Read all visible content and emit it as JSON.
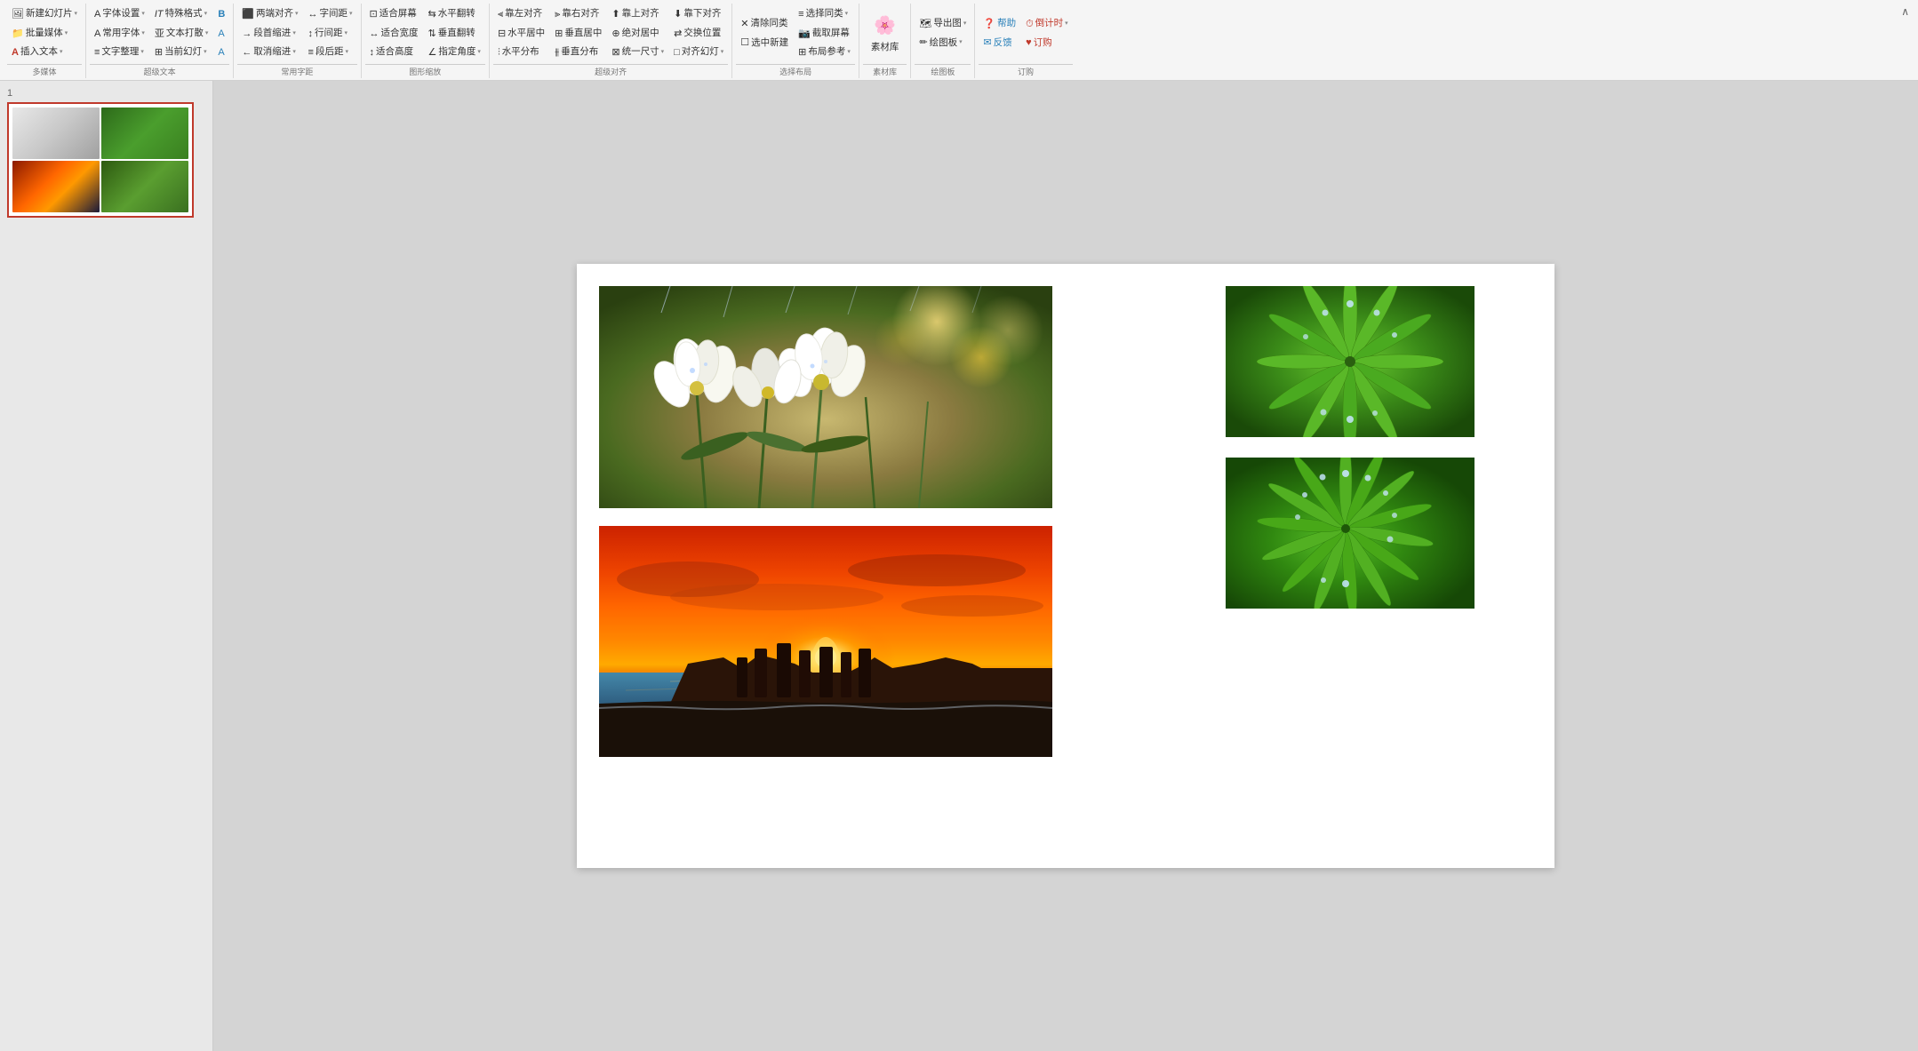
{
  "ribbon": {
    "groups": [
      {
        "id": "media",
        "label": "多媒体",
        "buttons": [
          {
            "id": "new-slide",
            "icon": "🖼",
            "text": "新建幻灯片",
            "arrow": true,
            "color": ""
          },
          {
            "id": "batch-media",
            "icon": "📁",
            "text": "批量媒体",
            "arrow": true,
            "color": "orange"
          },
          {
            "id": "insert-text",
            "icon": "A",
            "text": "插入文本▼",
            "arrow": false,
            "color": "orange"
          }
        ]
      },
      {
        "id": "supertext",
        "label": "超级文本",
        "buttons": [
          {
            "id": "font-setting",
            "icon": "A",
            "text": "字体设置",
            "arrow": true
          },
          {
            "id": "common-font",
            "icon": "A",
            "text": "常用字体",
            "arrow": true
          },
          {
            "id": "text-layout",
            "icon": "≡",
            "text": "文字整理",
            "arrow": true
          },
          {
            "id": "special-format",
            "icon": "IT",
            "text": "特殊格式",
            "arrow": true
          },
          {
            "id": "text-punch",
            "icon": "亚",
            "text": "文本打散",
            "arrow": true
          },
          {
            "id": "current-slide",
            "icon": "⊞",
            "text": "当前幻灯",
            "arrow": true
          },
          {
            "id": "bold-b",
            "icon": "B",
            "text": "",
            "arrow": false,
            "color": "blue"
          },
          {
            "id": "font-a1",
            "icon": "A",
            "text": "",
            "arrow": false,
            "color": "blue"
          },
          {
            "id": "font-a2",
            "icon": "A",
            "text": "",
            "arrow": false,
            "color": "blue"
          }
        ]
      },
      {
        "id": "spacing",
        "label": "常用字距",
        "buttons": [
          {
            "id": "align-justify",
            "icon": "≡",
            "text": "两端对齐",
            "arrow": true
          },
          {
            "id": "para-indent",
            "icon": "→≡",
            "text": "段首缩进",
            "arrow": true
          },
          {
            "id": "cancel-indent",
            "icon": "←≡",
            "text": "取消缩进",
            "arrow": true
          },
          {
            "id": "char-spacing",
            "icon": "↔A",
            "text": "字间距",
            "arrow": true
          },
          {
            "id": "line-spacing",
            "icon": "↕≡",
            "text": "行间距",
            "arrow": true
          },
          {
            "id": "para-after",
            "icon": "≡↓",
            "text": "段后距",
            "arrow": true
          }
        ]
      },
      {
        "id": "shape-zoom",
        "label": "图形缩放",
        "buttons": [
          {
            "id": "fit-screen",
            "icon": "⊡",
            "text": "适合屏幕",
            "arrow": false
          },
          {
            "id": "fit-width",
            "icon": "↔",
            "text": "适合宽度",
            "arrow": false
          },
          {
            "id": "fit-height",
            "icon": "↕",
            "text": "适合高度",
            "arrow": false
          },
          {
            "id": "h-flip",
            "icon": "↔",
            "text": "水平翻转",
            "arrow": false
          },
          {
            "id": "v-flip",
            "icon": "↕",
            "text": "垂直翻转",
            "arrow": false
          },
          {
            "id": "point-angle",
            "icon": "∠",
            "text": "指定角度",
            "arrow": true
          }
        ]
      },
      {
        "id": "super-align",
        "label": "超级对齐",
        "buttons": [
          {
            "id": "align-left",
            "icon": "⫷",
            "text": "靠左对齐",
            "arrow": false
          },
          {
            "id": "align-right",
            "icon": "⫸",
            "text": "靠右对齐",
            "arrow": false
          },
          {
            "id": "align-top",
            "icon": "⫶",
            "text": "靠上对齐",
            "arrow": false
          },
          {
            "id": "align-bottom",
            "icon": "⫵",
            "text": "靠下对齐",
            "arrow": false
          },
          {
            "id": "h-center",
            "icon": "⊟",
            "text": "水平居中",
            "arrow": false
          },
          {
            "id": "v-center",
            "icon": "⊞",
            "text": "垂直居中",
            "arrow": false
          },
          {
            "id": "abs-center",
            "icon": "⊕",
            "text": "绝对居中",
            "arrow": false
          },
          {
            "id": "h-distribute",
            "icon": "|||",
            "text": "水平分布",
            "arrow": false
          },
          {
            "id": "v-distribute",
            "icon": "≡≡",
            "text": "垂直分布",
            "arrow": false
          },
          {
            "id": "uniform-size",
            "icon": "⊠",
            "text": "统一尺寸",
            "arrow": true
          },
          {
            "id": "swap-pos",
            "icon": "⇄",
            "text": "交换位置",
            "arrow": false
          },
          {
            "id": "align-slide",
            "icon": "□",
            "text": "对齐幻灯",
            "arrow": true
          }
        ]
      },
      {
        "id": "select-layout",
        "label": "选择布局",
        "buttons": [
          {
            "id": "clear-same",
            "icon": "✕",
            "text": "清除同类",
            "arrow": false
          },
          {
            "id": "select-new",
            "icon": "☐",
            "text": "选中新建",
            "arrow": false
          },
          {
            "id": "select-same",
            "icon": "≡",
            "text": "选择同类",
            "arrow": false
          },
          {
            "id": "screenshot",
            "icon": "📷",
            "text": "截取屏幕",
            "arrow": false
          },
          {
            "id": "layout-ref",
            "icon": "⊞",
            "text": "布局参考",
            "arrow": true
          }
        ]
      },
      {
        "id": "material",
        "label": "素材库",
        "buttons": [
          {
            "id": "material-lib",
            "icon": "🌸",
            "text": "素材库",
            "arrow": false,
            "color": "orange"
          }
        ]
      },
      {
        "id": "drawing-board",
        "label": "绘图板",
        "buttons": [
          {
            "id": "export-map",
            "icon": "🗺",
            "text": "导出图▼",
            "arrow": true
          },
          {
            "id": "drawing-board-btn",
            "icon": "✏",
            "text": "绘图板▼",
            "arrow": true
          }
        ]
      },
      {
        "id": "order",
        "label": "订购",
        "buttons": [
          {
            "id": "help",
            "icon": "?",
            "text": "帮助",
            "color": "blue"
          },
          {
            "id": "feedback",
            "icon": "✉",
            "text": "反馈",
            "color": "blue"
          },
          {
            "id": "countdown",
            "icon": "⏱",
            "text": "倒计时▼",
            "color": "orange"
          },
          {
            "id": "subscribe",
            "icon": "♥",
            "text": "订购",
            "color": "orange"
          }
        ]
      }
    ]
  },
  "slide": {
    "number": "1",
    "photos": [
      {
        "id": "flowers",
        "desc": "白色花朵特写",
        "position": "top-left"
      },
      {
        "id": "green1",
        "desc": "绿色植物叶片",
        "position": "top-right"
      },
      {
        "id": "sunset",
        "desc": "日落海岸风景",
        "position": "bottom-left"
      },
      {
        "id": "green2",
        "desc": "绿色植物叶片2",
        "position": "bottom-right"
      }
    ]
  },
  "ribbon_rows": {
    "row1": {
      "items": [
        {
          "text": "新建幻灯片",
          "icon": "slide"
        },
        {
          "text": "批量媒体",
          "icon": "folder"
        },
        {
          "text": "插入文本▼",
          "icon": "text"
        },
        {
          "sep": true
        },
        {
          "text": "字体设置▼",
          "icon": "font"
        },
        {
          "text": "常用字体▼",
          "icon": "font2"
        },
        {
          "text": "文字整理▼",
          "icon": "align"
        },
        {
          "text": "特殊格式▼",
          "icon": "it"
        },
        {
          "text": "文本打散▼",
          "icon": "scatter"
        },
        {
          "text": "当前幻灯▼",
          "icon": "slide2"
        },
        {
          "text": "B",
          "icon": "bold"
        },
        {
          "text": "A",
          "icon": "a1"
        },
        {
          "text": "A",
          "icon": "a2"
        },
        {
          "sep": true
        },
        {
          "text": "两端对齐▼",
          "icon": "justify"
        },
        {
          "text": "段首缩进▼",
          "icon": "indent"
        },
        {
          "text": "取消缩进▼",
          "icon": "unindent"
        },
        {
          "text": "字间距▼",
          "icon": "charspace"
        },
        {
          "text": "行间距▼",
          "icon": "linespace"
        },
        {
          "text": "段后距▼",
          "icon": "paraafter"
        },
        {
          "sep": true
        },
        {
          "text": "适合屏幕",
          "icon": "fitscreen"
        },
        {
          "text": "适合宽度",
          "icon": "fitwidth"
        },
        {
          "text": "适合高度",
          "icon": "fitheight"
        },
        {
          "text": "水平翻转",
          "icon": "hflip"
        },
        {
          "text": "垂直翻转",
          "icon": "vflip"
        },
        {
          "text": "指定角度▼",
          "icon": "angle"
        },
        {
          "sep": true
        },
        {
          "text": "靠左对齐",
          "icon": "alignl"
        },
        {
          "text": "靠右对齐",
          "icon": "alignr"
        },
        {
          "text": "靠上对齐",
          "icon": "alignt"
        },
        {
          "text": "靠下对齐",
          "icon": "alignb"
        },
        {
          "text": "水平居中",
          "icon": "hcenter"
        },
        {
          "text": "垂直居中",
          "icon": "vcenter"
        },
        {
          "text": "绝对居中",
          "icon": "abscenter"
        },
        {
          "text": "水平分布",
          "icon": "hdist"
        },
        {
          "text": "垂直分布",
          "icon": "vdist"
        },
        {
          "text": "统一尺寸▼",
          "icon": "unisize"
        },
        {
          "text": "交换位置",
          "icon": "swap"
        },
        {
          "text": "对齐幻灯▼",
          "icon": "alignslide"
        },
        {
          "sep": true
        },
        {
          "text": "清除同类",
          "icon": "clearsame"
        },
        {
          "text": "选中新建",
          "icon": "selectnew"
        },
        {
          "text": "选择同类▼",
          "icon": "selectsame"
        },
        {
          "text": "截取屏幕",
          "icon": "screenshot"
        },
        {
          "text": "布局参考▼",
          "icon": "layout"
        },
        {
          "sep": true
        },
        {
          "text": "素材库",
          "icon": "material"
        },
        {
          "sep": true
        },
        {
          "text": "导出图▼",
          "icon": "export"
        },
        {
          "text": "绘图板▼",
          "icon": "draw"
        },
        {
          "sep": true
        },
        {
          "text": "帮助",
          "icon": "help"
        },
        {
          "text": "反馈",
          "icon": "feedback"
        },
        {
          "text": "倒计时▼",
          "icon": "countdown"
        },
        {
          "text": "订购",
          "icon": "subscribe"
        }
      ]
    }
  }
}
